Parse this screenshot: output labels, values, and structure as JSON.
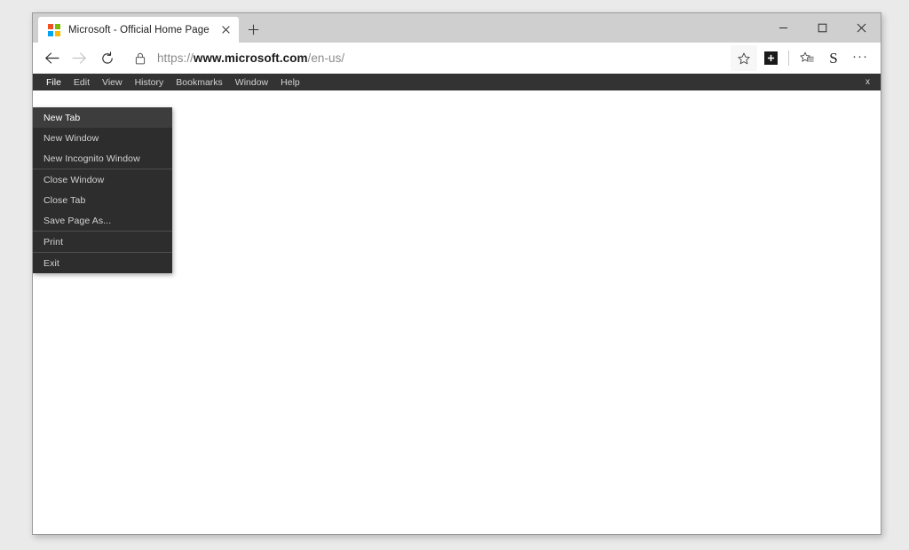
{
  "window": {
    "controls": {
      "minimize_label": "−",
      "maximize_label": "□",
      "close_label": "×"
    }
  },
  "tabstrip": {
    "tabs": [
      {
        "title": "Microsoft - Official Home Page",
        "favicon": "microsoft-logo-icon",
        "close_label": "×",
        "active": true
      }
    ],
    "new_tab_label": "+"
  },
  "toolbar": {
    "back_icon": "arrow-left-icon",
    "forward_icon": "arrow-right-icon",
    "reload_icon": "reload-icon",
    "lock_icon": "lock-icon",
    "url": {
      "scheme": "https://",
      "host": "www.microsoft.com",
      "path": "/en-us/",
      "full": "https://www.microsoft.com/en-us/"
    },
    "actions": [
      {
        "name": "favorite-star-icon",
        "label": "☆"
      },
      {
        "name": "collections-add-icon",
        "label": "+"
      },
      {
        "name": "reading-list-icon",
        "label": "☆"
      },
      {
        "name": "profile-icon",
        "label": "S"
      },
      {
        "name": "more-options-icon",
        "label": "···"
      }
    ]
  },
  "menubar": {
    "items": [
      {
        "label": "File",
        "open": true
      },
      {
        "label": "Edit",
        "open": false
      },
      {
        "label": "View",
        "open": false
      },
      {
        "label": "History",
        "open": false
      },
      {
        "label": "Bookmarks",
        "open": false
      },
      {
        "label": "Window",
        "open": false
      },
      {
        "label": "Help",
        "open": false
      }
    ],
    "close_label": "x"
  },
  "file_menu": {
    "entries": [
      {
        "label": "New Tab",
        "type": "item",
        "highlighted": true
      },
      {
        "label": "New Window",
        "type": "item",
        "highlighted": false
      },
      {
        "label": "New Incognito Window",
        "type": "item",
        "highlighted": false
      },
      {
        "label": "",
        "type": "separator"
      },
      {
        "label": "Close Window",
        "type": "item",
        "highlighted": false
      },
      {
        "label": "Close Tab",
        "type": "item",
        "highlighted": false
      },
      {
        "label": "Save Page As...",
        "type": "item",
        "highlighted": false
      },
      {
        "label": "",
        "type": "separator"
      },
      {
        "label": "Print",
        "type": "item",
        "highlighted": false
      },
      {
        "label": "",
        "type": "separator"
      },
      {
        "label": "Exit",
        "type": "item",
        "highlighted": false
      }
    ]
  },
  "colors": {
    "titlebar_bg": "#cfcfcf",
    "menubar_bg": "#333333",
    "menu_bg": "#2d2d2d",
    "menu_highlight": "#3d3d3d",
    "page_bg": "#ffffff",
    "ms_red": "#F25022",
    "ms_green": "#7FBA00",
    "ms_blue": "#00A4EF",
    "ms_yellow": "#FFB900"
  },
  "page": {
    "content": ""
  }
}
